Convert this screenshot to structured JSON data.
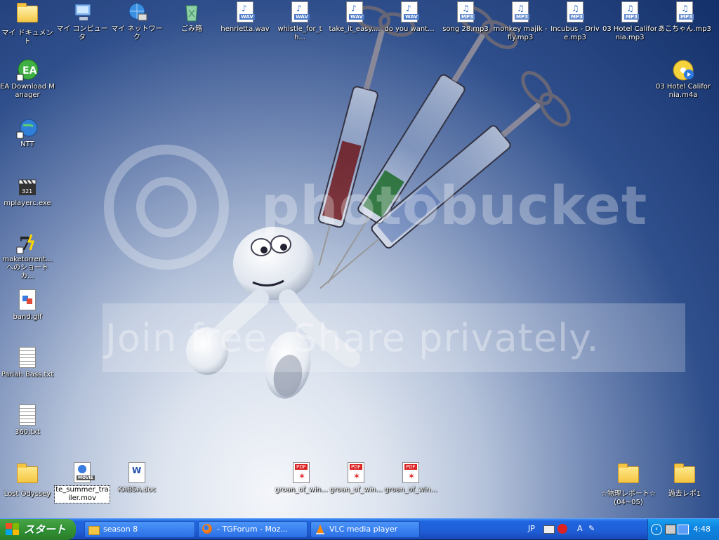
{
  "watermark": {
    "brand": "photobucket",
    "tagline": "Join free. Share privately."
  },
  "desktop_icons": [
    {
      "id": "my-documents",
      "label": "マイ ドキュメント",
      "kind": "folder"
    },
    {
      "id": "my-computer",
      "label": "マイ コンピュータ",
      "kind": "computer"
    },
    {
      "id": "my-network",
      "label": "マイ ネットワーク",
      "kind": "network"
    },
    {
      "id": "recycle-bin",
      "label": "ごみ箱",
      "kind": "recycle"
    },
    {
      "id": "henrietta",
      "label": "henrietta.wav",
      "kind": "wav"
    },
    {
      "id": "whistle",
      "label": "whistle_for_th...",
      "kind": "wav"
    },
    {
      "id": "take-it-easy",
      "label": "take_it_easy....",
      "kind": "wav"
    },
    {
      "id": "do-you-want",
      "label": "do you want...",
      "kind": "wav"
    },
    {
      "id": "song28",
      "label": "song 28.mp3",
      "kind": "mp3"
    },
    {
      "id": "monkey-majik",
      "label": "monkey majik - fly.mp3",
      "kind": "mp3"
    },
    {
      "id": "incubus",
      "label": "Incubus - Drive.mp3",
      "kind": "mp3"
    },
    {
      "id": "hotel-california-mp3",
      "label": "03 Hotel California.mp3",
      "kind": "mp3"
    },
    {
      "id": "akochan",
      "label": "あこちゃん.mp3",
      "kind": "mp3"
    },
    {
      "id": "ea-download",
      "label": "EA Download Manager",
      "kind": "ea"
    },
    {
      "id": "hotel-california-m4a",
      "label": "03 Hotel California.m4a",
      "kind": "m4a"
    },
    {
      "id": "ntt",
      "label": "NTT",
      "kind": "globe"
    },
    {
      "id": "mplayerc",
      "label": "mplayerc.exe",
      "kind": "clapper"
    },
    {
      "id": "maketorrent",
      "label": "maketorrent... へのショートカ...",
      "kind": "seven"
    },
    {
      "id": "band-gif",
      "label": "band.gif",
      "kind": "gif"
    },
    {
      "id": "pariah-bass",
      "label": "Pariah Bass.txt",
      "kind": "txt"
    },
    {
      "id": "file-360",
      "label": "360.txt",
      "kind": "txt"
    },
    {
      "id": "lost-odyssey",
      "label": "Lost Odyssey",
      "kind": "folder"
    },
    {
      "id": "te-summer",
      "label": "te_summer_trailer.mov",
      "kind": "movie"
    },
    {
      "id": "kabsa",
      "label": "KABSA.doc",
      "kind": "doc"
    },
    {
      "id": "groan1",
      "label": "groan_of_win...",
      "kind": "pdf"
    },
    {
      "id": "groan2",
      "label": "groan_of_win...",
      "kind": "pdf"
    },
    {
      "id": "groan3",
      "label": "groan_of_win...",
      "kind": "pdf"
    },
    {
      "id": "physics-report",
      "label": "☆物理レポート☆(04~05)",
      "kind": "folder"
    },
    {
      "id": "past-report",
      "label": "過去レポ1",
      "kind": "folder"
    }
  ],
  "file_tags": {
    "wav": "WAV",
    "mp3": "MP3",
    "pdf": "PDF",
    "movie": "MOVIE",
    "txt": "",
    "gif": "",
    "doc": "W"
  },
  "taskbar": {
    "start_label": "スタート",
    "buttons": [
      {
        "id": "season8",
        "label": "season 8",
        "icon": "folder-icon"
      },
      {
        "id": "firefox",
        "label": "- TGForum - Moz...",
        "icon": "firefox-icon"
      },
      {
        "id": "vlc",
        "label": "VLC media player",
        "icon": "vlc-cone-icon"
      }
    ],
    "lang_indicator": "JP",
    "ime_mode": "A",
    "clock": "4:48"
  },
  "colors": {
    "taskbar_blue": "#245edb",
    "start_green": "#3a9a3a",
    "tray_blue": "#0f85e0"
  }
}
